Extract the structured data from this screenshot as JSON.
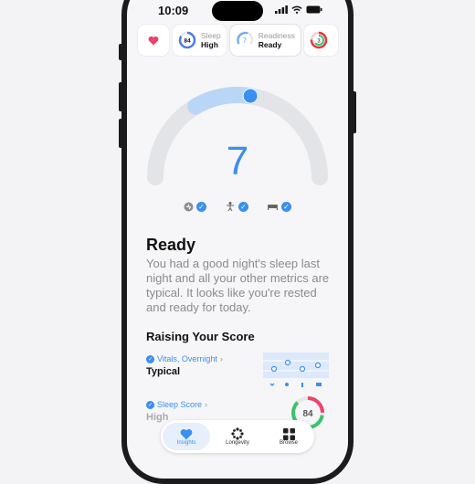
{
  "status": {
    "time": "10:09"
  },
  "chips": [
    {
      "icon": "heart-icon",
      "label": "",
      "value": ""
    },
    {
      "icon": "sleep-ring-icon",
      "ring_value": "84",
      "label": "Sleep",
      "value": "High"
    },
    {
      "icon": "readiness-ring-icon",
      "ring_value": "7",
      "label": "Readiness",
      "value": "Ready"
    },
    {
      "icon": "activity-ring-icon",
      "ring_value": "3",
      "label": "",
      "value": ""
    }
  ],
  "gauge": {
    "score": "7",
    "level": 0.55
  },
  "checks": [
    {
      "icon": "vitals-icon",
      "checked": true
    },
    {
      "icon": "body-icon",
      "checked": true
    },
    {
      "icon": "bed-icon",
      "checked": true
    }
  ],
  "state": {
    "title": "Ready",
    "description": "You had a good night's sleep last night and all your other metrics are typical. It looks like you're rested and ready for today."
  },
  "section": {
    "title": "Raising Your Score"
  },
  "metrics": [
    {
      "label": "Vitals, Overnight",
      "value": "Typical"
    },
    {
      "label": "Sleep Score",
      "value": "High",
      "ring_value": "84"
    }
  ],
  "tabs": [
    {
      "label": "Insights",
      "icon": "heart-icon",
      "active": true
    },
    {
      "label": "Longevity",
      "icon": "longevity-icon",
      "active": false
    },
    {
      "label": "Browse",
      "icon": "grid-icon",
      "active": false
    }
  ],
  "colors": {
    "accent": "#3a8ff0",
    "gauge_track": "#e3e4e8"
  }
}
